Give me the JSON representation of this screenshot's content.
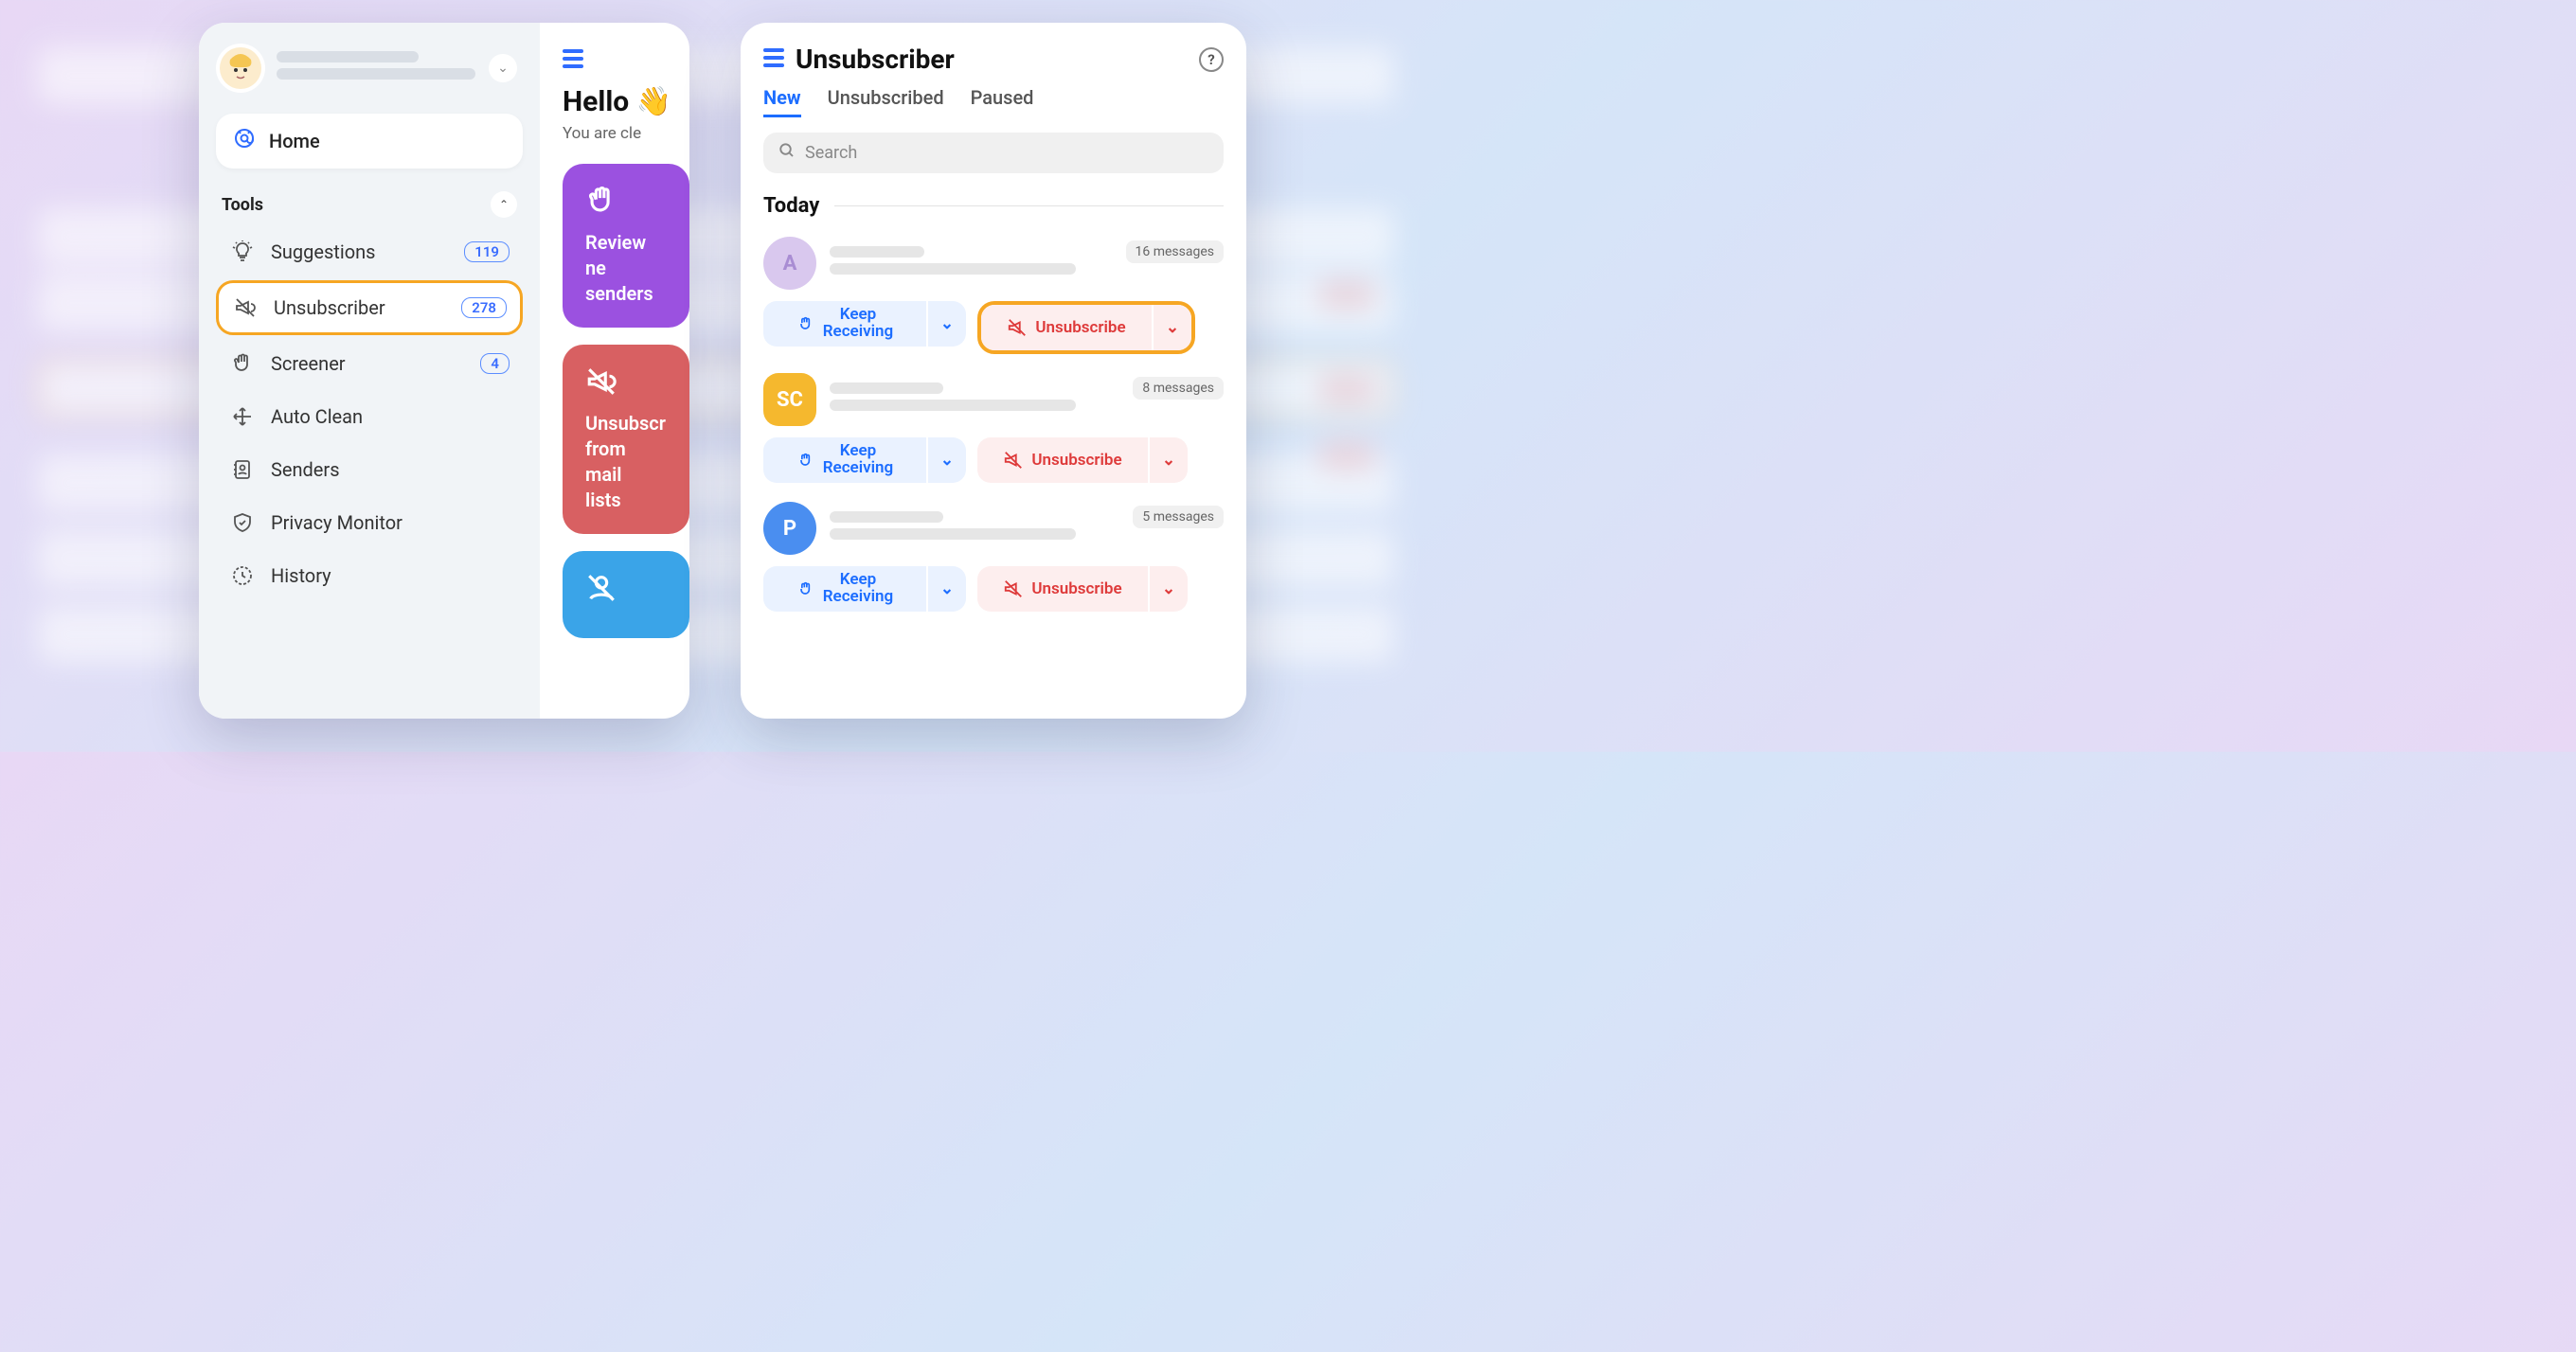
{
  "sidebar": {
    "home_label": "Home",
    "section_title": "Tools",
    "items": [
      {
        "label": "Suggestions",
        "badge": "119"
      },
      {
        "label": "Unsubscriber",
        "badge": "278"
      },
      {
        "label": "Screener",
        "badge": "4"
      },
      {
        "label": "Auto Clean"
      },
      {
        "label": "Senders"
      },
      {
        "label": "Privacy Monitor"
      },
      {
        "label": "History"
      }
    ]
  },
  "mainstrip": {
    "greeting": "Hello 👋",
    "subtitle": "You are cle",
    "cards": {
      "purple": "Review ne\nsenders",
      "red": "Unsubscr\nfrom mail\nlists"
    }
  },
  "right": {
    "title": "Unsubscriber",
    "tabs": [
      "New",
      "Unsubscribed",
      "Paused"
    ],
    "active_tab": 0,
    "search_placeholder": "Search",
    "section_label": "Today",
    "senders": [
      {
        "avatar": "A",
        "count": "16 messages"
      },
      {
        "avatar": "SC",
        "count": "8 messages"
      },
      {
        "avatar": "P",
        "count": "5 messages"
      }
    ],
    "keep_label": "Keep\nReceiving",
    "unsub_label": "Unsubscribe"
  }
}
